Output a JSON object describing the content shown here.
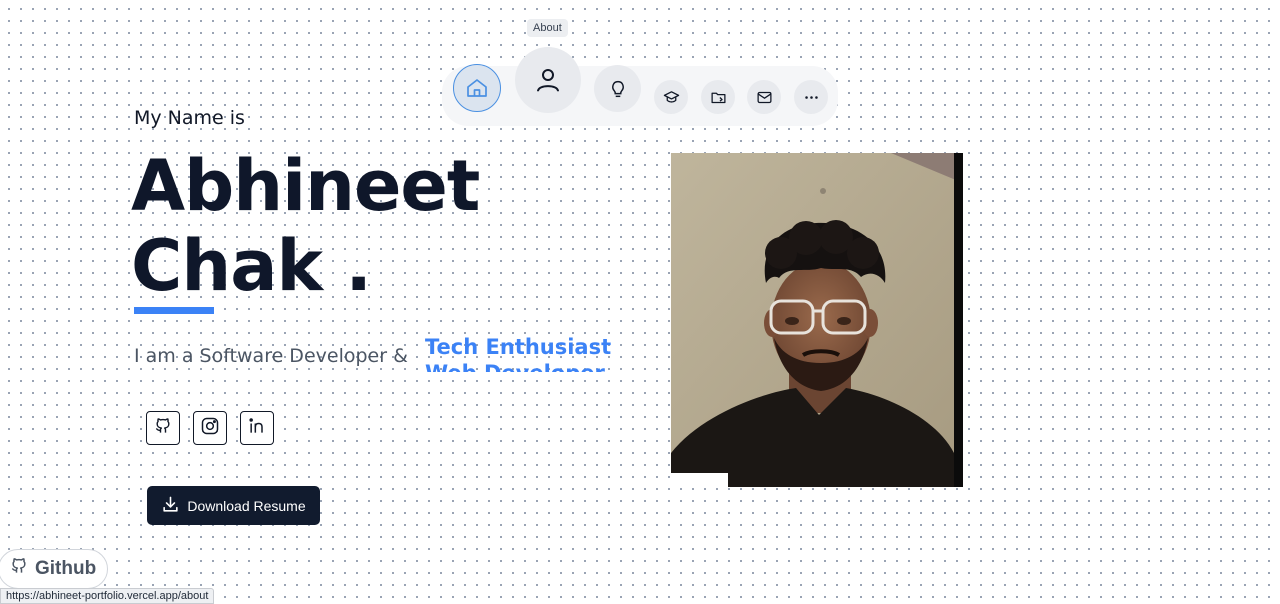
{
  "nav": {
    "tooltip": "About",
    "items": [
      {
        "name": "home",
        "icon": "home-icon"
      },
      {
        "name": "about",
        "icon": "user-icon"
      },
      {
        "name": "skills",
        "icon": "lightbulb-icon"
      },
      {
        "name": "education",
        "icon": "graduation-cap-icon"
      },
      {
        "name": "projects",
        "icon": "folder-icon"
      },
      {
        "name": "contact",
        "icon": "mail-icon"
      },
      {
        "name": "more",
        "icon": "more-icon"
      }
    ]
  },
  "hero": {
    "intro": "My Name is",
    "first_name": "Abhineet",
    "last_name": "Chak .",
    "role_prefix": "I am a Software Developer &",
    "roles": [
      "Tech Enthusiast",
      "Web Developer"
    ]
  },
  "social": {
    "links": [
      {
        "name": "github",
        "icon": "github-icon"
      },
      {
        "name": "instagram",
        "icon": "instagram-icon"
      },
      {
        "name": "linkedin",
        "icon": "linkedin-icon"
      }
    ]
  },
  "actions": {
    "download_label": "Download Resume"
  },
  "floating": {
    "github_label": "Github"
  },
  "status_bar": {
    "url": "https://abhineet-portfolio.vercel.app/about"
  },
  "colors": {
    "accent": "#3b82f6",
    "button_dark": "#111b2e",
    "heading": "#0f172a"
  }
}
